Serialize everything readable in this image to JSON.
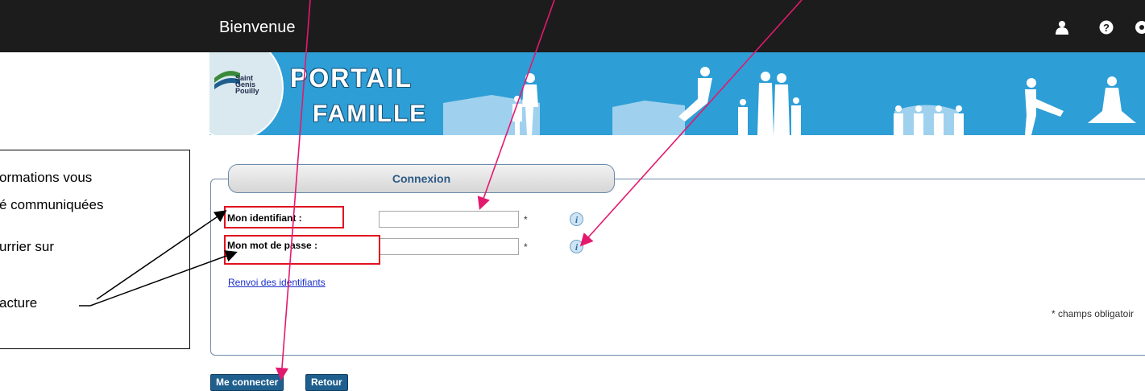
{
  "header": {
    "welcome": "Bienvenue",
    "icons": [
      "user-icon",
      "help-icon",
      "settings-icon"
    ]
  },
  "banner": {
    "logo_lines": [
      "Saint",
      "Genis",
      "Pouilly"
    ],
    "brand_line1": "PORTAIL",
    "brand_line2": "FAMILLE"
  },
  "form": {
    "title": "Connexion",
    "identifiant_label": "Mon identifiant :",
    "identifiant_value": "",
    "password_label": "Mon mot de passe :",
    "password_value": "",
    "required_mark": "*",
    "resend_link": "Renvoi des identifiants",
    "mandatory_note": "* champs obligatoir"
  },
  "buttons": {
    "connect": "Me connecter",
    "back": "Retour"
  },
  "callout": {
    "lines": [
      "ormations vous",
      "é communiquées",
      "urrier sur",
      "",
      "acture"
    ]
  },
  "colors": {
    "topbar": "#1c1c1c",
    "banner": "#2e9ed6",
    "button": "#1f5f8e",
    "tab_text": "#2c5a86",
    "annotation_arrow": "#e3196e",
    "highlight_box": "#e0121f"
  }
}
